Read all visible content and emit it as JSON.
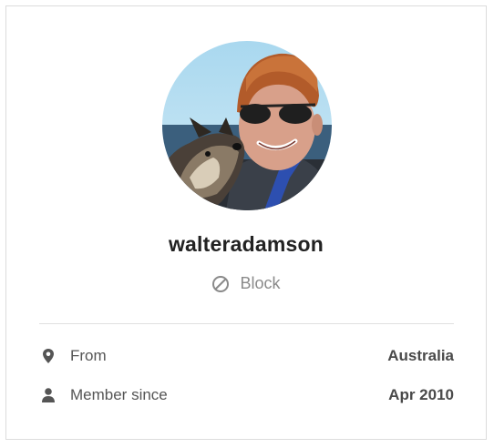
{
  "profile": {
    "username": "walteradamson",
    "block_label": "Block"
  },
  "details": {
    "from_label": "From",
    "from_value": "Australia",
    "member_label": "Member since",
    "member_value": "Apr 2010"
  },
  "icons": {
    "block": "block-icon",
    "location": "location-pin-icon",
    "member": "person-icon"
  },
  "colors": {
    "text_primary": "#222222",
    "text_muted": "#8a8a8a",
    "divider": "#e0e0e0",
    "border": "#dcdcdc"
  }
}
